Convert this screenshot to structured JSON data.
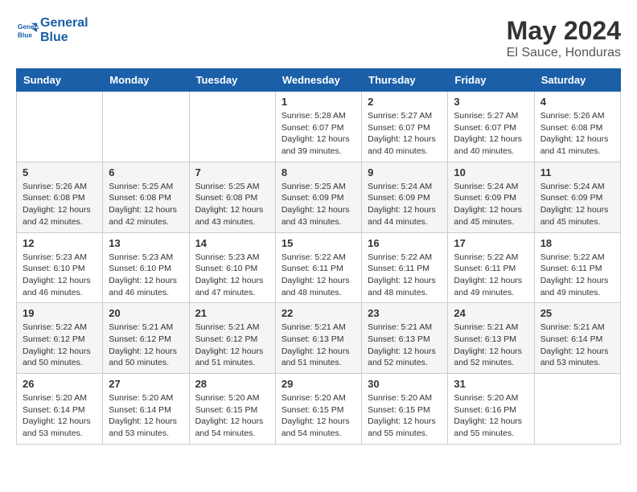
{
  "header": {
    "logo_line1": "General",
    "logo_line2": "Blue",
    "month": "May 2024",
    "location": "El Sauce, Honduras"
  },
  "days_of_week": [
    "Sunday",
    "Monday",
    "Tuesday",
    "Wednesday",
    "Thursday",
    "Friday",
    "Saturday"
  ],
  "weeks": [
    [
      {
        "day": "",
        "info": ""
      },
      {
        "day": "",
        "info": ""
      },
      {
        "day": "",
        "info": ""
      },
      {
        "day": "1",
        "info": "Sunrise: 5:28 AM\nSunset: 6:07 PM\nDaylight: 12 hours\nand 39 minutes."
      },
      {
        "day": "2",
        "info": "Sunrise: 5:27 AM\nSunset: 6:07 PM\nDaylight: 12 hours\nand 40 minutes."
      },
      {
        "day": "3",
        "info": "Sunrise: 5:27 AM\nSunset: 6:07 PM\nDaylight: 12 hours\nand 40 minutes."
      },
      {
        "day": "4",
        "info": "Sunrise: 5:26 AM\nSunset: 6:08 PM\nDaylight: 12 hours\nand 41 minutes."
      }
    ],
    [
      {
        "day": "5",
        "info": "Sunrise: 5:26 AM\nSunset: 6:08 PM\nDaylight: 12 hours\nand 42 minutes."
      },
      {
        "day": "6",
        "info": "Sunrise: 5:25 AM\nSunset: 6:08 PM\nDaylight: 12 hours\nand 42 minutes."
      },
      {
        "day": "7",
        "info": "Sunrise: 5:25 AM\nSunset: 6:08 PM\nDaylight: 12 hours\nand 43 minutes."
      },
      {
        "day": "8",
        "info": "Sunrise: 5:25 AM\nSunset: 6:09 PM\nDaylight: 12 hours\nand 43 minutes."
      },
      {
        "day": "9",
        "info": "Sunrise: 5:24 AM\nSunset: 6:09 PM\nDaylight: 12 hours\nand 44 minutes."
      },
      {
        "day": "10",
        "info": "Sunrise: 5:24 AM\nSunset: 6:09 PM\nDaylight: 12 hours\nand 45 minutes."
      },
      {
        "day": "11",
        "info": "Sunrise: 5:24 AM\nSunset: 6:09 PM\nDaylight: 12 hours\nand 45 minutes."
      }
    ],
    [
      {
        "day": "12",
        "info": "Sunrise: 5:23 AM\nSunset: 6:10 PM\nDaylight: 12 hours\nand 46 minutes."
      },
      {
        "day": "13",
        "info": "Sunrise: 5:23 AM\nSunset: 6:10 PM\nDaylight: 12 hours\nand 46 minutes."
      },
      {
        "day": "14",
        "info": "Sunrise: 5:23 AM\nSunset: 6:10 PM\nDaylight: 12 hours\nand 47 minutes."
      },
      {
        "day": "15",
        "info": "Sunrise: 5:22 AM\nSunset: 6:11 PM\nDaylight: 12 hours\nand 48 minutes."
      },
      {
        "day": "16",
        "info": "Sunrise: 5:22 AM\nSunset: 6:11 PM\nDaylight: 12 hours\nand 48 minutes."
      },
      {
        "day": "17",
        "info": "Sunrise: 5:22 AM\nSunset: 6:11 PM\nDaylight: 12 hours\nand 49 minutes."
      },
      {
        "day": "18",
        "info": "Sunrise: 5:22 AM\nSunset: 6:11 PM\nDaylight: 12 hours\nand 49 minutes."
      }
    ],
    [
      {
        "day": "19",
        "info": "Sunrise: 5:22 AM\nSunset: 6:12 PM\nDaylight: 12 hours\nand 50 minutes."
      },
      {
        "day": "20",
        "info": "Sunrise: 5:21 AM\nSunset: 6:12 PM\nDaylight: 12 hours\nand 50 minutes."
      },
      {
        "day": "21",
        "info": "Sunrise: 5:21 AM\nSunset: 6:12 PM\nDaylight: 12 hours\nand 51 minutes."
      },
      {
        "day": "22",
        "info": "Sunrise: 5:21 AM\nSunset: 6:13 PM\nDaylight: 12 hours\nand 51 minutes."
      },
      {
        "day": "23",
        "info": "Sunrise: 5:21 AM\nSunset: 6:13 PM\nDaylight: 12 hours\nand 52 minutes."
      },
      {
        "day": "24",
        "info": "Sunrise: 5:21 AM\nSunset: 6:13 PM\nDaylight: 12 hours\nand 52 minutes."
      },
      {
        "day": "25",
        "info": "Sunrise: 5:21 AM\nSunset: 6:14 PM\nDaylight: 12 hours\nand 53 minutes."
      }
    ],
    [
      {
        "day": "26",
        "info": "Sunrise: 5:20 AM\nSunset: 6:14 PM\nDaylight: 12 hours\nand 53 minutes."
      },
      {
        "day": "27",
        "info": "Sunrise: 5:20 AM\nSunset: 6:14 PM\nDaylight: 12 hours\nand 53 minutes."
      },
      {
        "day": "28",
        "info": "Sunrise: 5:20 AM\nSunset: 6:15 PM\nDaylight: 12 hours\nand 54 minutes."
      },
      {
        "day": "29",
        "info": "Sunrise: 5:20 AM\nSunset: 6:15 PM\nDaylight: 12 hours\nand 54 minutes."
      },
      {
        "day": "30",
        "info": "Sunrise: 5:20 AM\nSunset: 6:15 PM\nDaylight: 12 hours\nand 55 minutes."
      },
      {
        "day": "31",
        "info": "Sunrise: 5:20 AM\nSunset: 6:16 PM\nDaylight: 12 hours\nand 55 minutes."
      },
      {
        "day": "",
        "info": ""
      }
    ]
  ]
}
